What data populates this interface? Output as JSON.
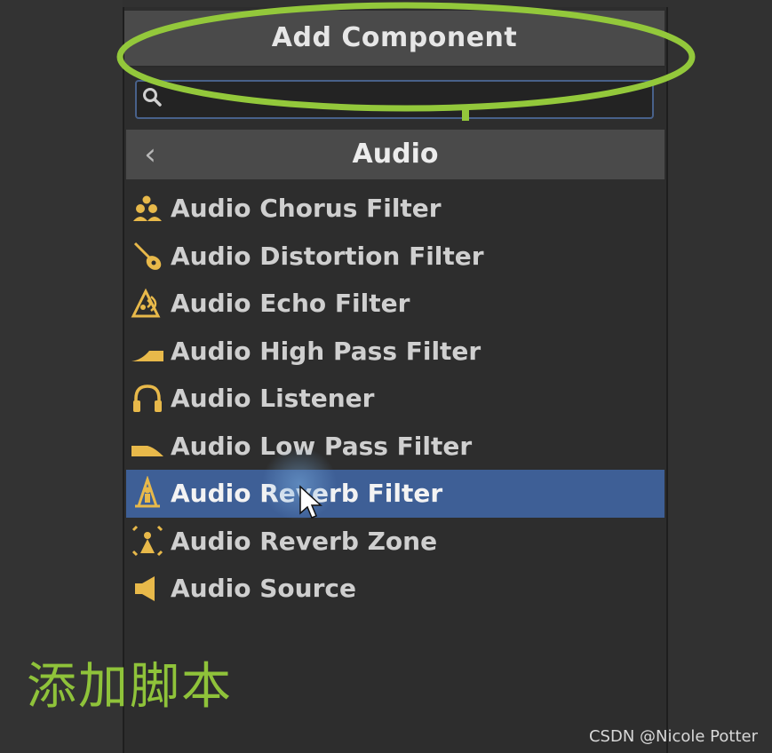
{
  "popup": {
    "title": "Add Component",
    "search": {
      "value": "",
      "placeholder": ""
    },
    "category": {
      "back_icon": "chevron-left-icon",
      "title": "Audio"
    },
    "items": [
      {
        "label": "Audio Chorus Filter",
        "icon": "chorus-filter-icon",
        "selected": false
      },
      {
        "label": "Audio Distortion Filter",
        "icon": "distortion-filter-icon",
        "selected": false
      },
      {
        "label": "Audio Echo Filter",
        "icon": "echo-filter-icon",
        "selected": false
      },
      {
        "label": "Audio High Pass Filter",
        "icon": "high-pass-filter-icon",
        "selected": false
      },
      {
        "label": "Audio Listener",
        "icon": "headphones-icon",
        "selected": false
      },
      {
        "label": "Audio Low Pass Filter",
        "icon": "low-pass-filter-icon",
        "selected": false
      },
      {
        "label": "Audio Reverb Filter",
        "icon": "reverb-filter-icon",
        "selected": true
      },
      {
        "label": "Audio Reverb Zone",
        "icon": "reverb-zone-icon",
        "selected": false
      },
      {
        "label": "Audio Source",
        "icon": "speaker-icon",
        "selected": false
      }
    ]
  },
  "annotation": {
    "text": "添加脚本",
    "color": "#8fc33a"
  },
  "watermark": "CSDN @Nicole Potter",
  "colors": {
    "selected_row": "#3e5f96",
    "icon_gold": "#e8b94a",
    "search_border": "#48618a"
  }
}
